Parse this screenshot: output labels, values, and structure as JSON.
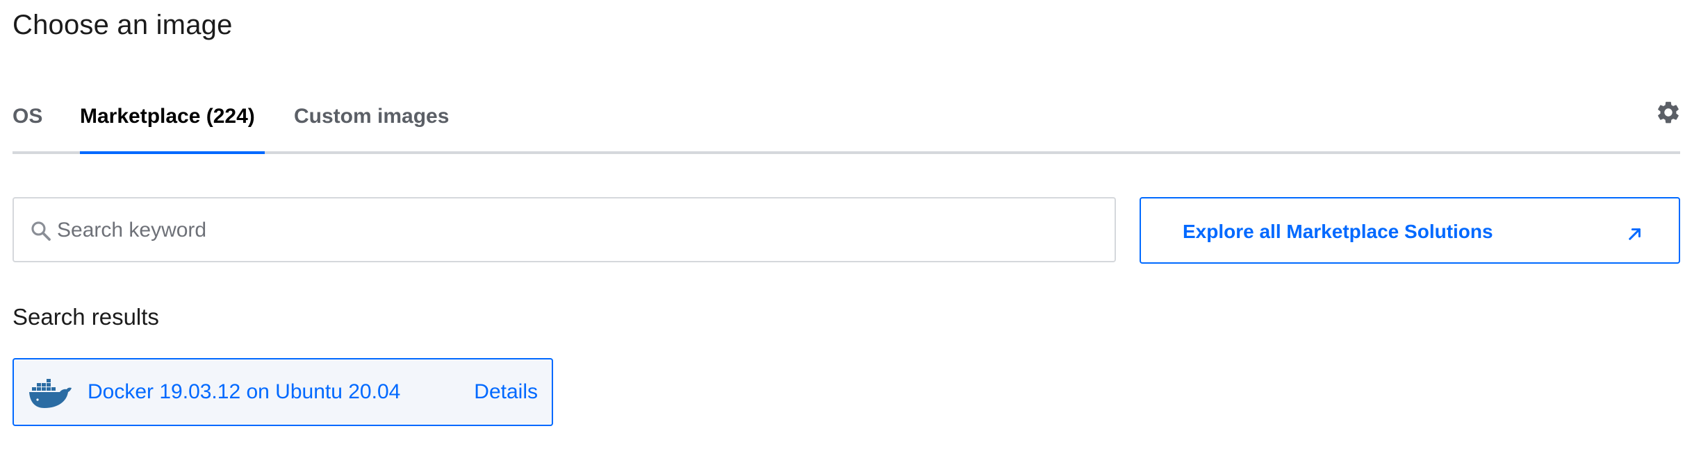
{
  "page": {
    "title": "Choose an image"
  },
  "tabs": [
    {
      "label": "OS",
      "active": false
    },
    {
      "label": "Marketplace (224)",
      "active": true
    },
    {
      "label": "Custom images",
      "active": false
    }
  ],
  "settings": {
    "icon": "gear-icon"
  },
  "search": {
    "placeholder": "Search keyword",
    "value": "",
    "icon": "search-icon"
  },
  "explore": {
    "label": "Explore all Marketplace Solutions",
    "icon": "external-link-icon"
  },
  "results": {
    "heading": "Search results",
    "items": [
      {
        "title": "Docker 19.03.12 on Ubuntu 20.04",
        "details_label": "Details",
        "icon": "docker-icon"
      }
    ]
  },
  "colors": {
    "accent": "#0069ff",
    "tab_inactive": "#5b5f66",
    "divider": "#d5d8dc",
    "card_bg": "#f3f6fb",
    "docker_blue": "#2b6ca3"
  }
}
